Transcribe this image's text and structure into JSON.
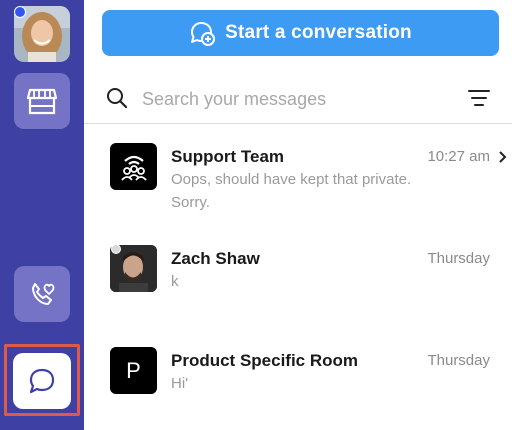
{
  "sidebar": {
    "avatar_icon": "user-avatar",
    "store_icon": "storefront-icon",
    "calls_icon": "phone-heart-icon",
    "chat_icon": "chat-bubble-icon",
    "colors": {
      "background": "#3e40a4",
      "button": "#7473c5",
      "highlight_outline": "#e05a4a",
      "status_dot": "#3456f0"
    }
  },
  "header": {
    "start_button_label": "Start a conversation",
    "start_button_color": "#3d9bf4"
  },
  "search": {
    "placeholder": "Search your messages",
    "value": ""
  },
  "conversations": [
    {
      "name": "Support Team",
      "time": "10:27 am",
      "preview": "Oops, should have kept that private. Sorry.",
      "icon": "support-team-icon"
    },
    {
      "name": "Zach Shaw",
      "time": "Thursday",
      "preview": "k",
      "icon": "user-photo"
    },
    {
      "name": "Product Specific Room",
      "time": "Thursday",
      "preview": "Hi'",
      "initial": "P"
    }
  ]
}
